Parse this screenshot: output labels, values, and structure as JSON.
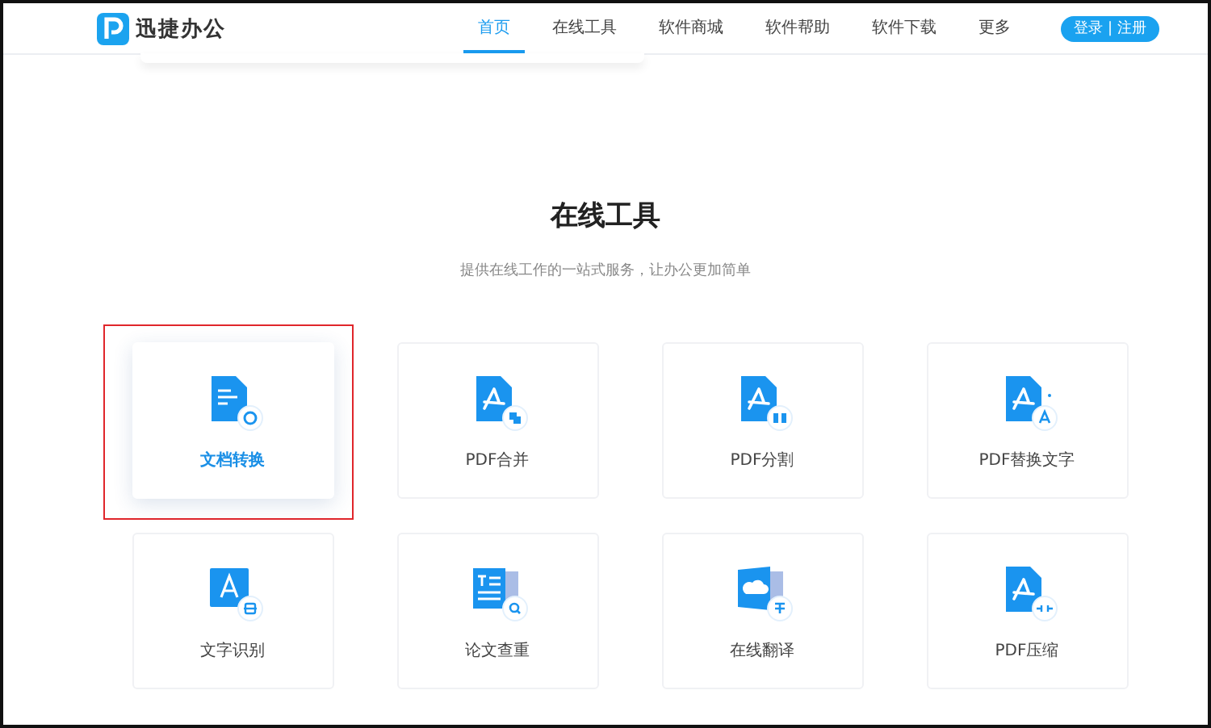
{
  "header": {
    "logo_text": "迅捷办公",
    "nav": [
      {
        "label": "首页",
        "selected": true
      },
      {
        "label": "在线工具",
        "selected": false
      },
      {
        "label": "软件商城",
        "selected": false
      },
      {
        "label": "软件帮助",
        "selected": false
      },
      {
        "label": "软件下载",
        "selected": false
      },
      {
        "label": "更多",
        "selected": false
      }
    ],
    "login_button": "登录 | 注册"
  },
  "section": {
    "title": "在线工具",
    "subtitle": "提供在线工作的一站式服务，让办公更加简单"
  },
  "tools": [
    {
      "label": "文档转换",
      "kind": "convert",
      "selected": true,
      "outlined": true
    },
    {
      "label": "PDF合并",
      "kind": "merge",
      "selected": false,
      "outlined": false
    },
    {
      "label": "PDF分割",
      "kind": "split",
      "selected": false,
      "outlined": false
    },
    {
      "label": "PDF替换文字",
      "kind": "replace",
      "selected": false,
      "outlined": false
    },
    {
      "label": "文字识别",
      "kind": "ocr",
      "selected": false,
      "outlined": false
    },
    {
      "label": "论文查重",
      "kind": "check",
      "selected": false,
      "outlined": false
    },
    {
      "label": "在线翻译",
      "kind": "translate",
      "selected": false,
      "outlined": false
    },
    {
      "label": "PDF压缩",
      "kind": "compress",
      "selected": false,
      "outlined": false
    }
  ]
}
